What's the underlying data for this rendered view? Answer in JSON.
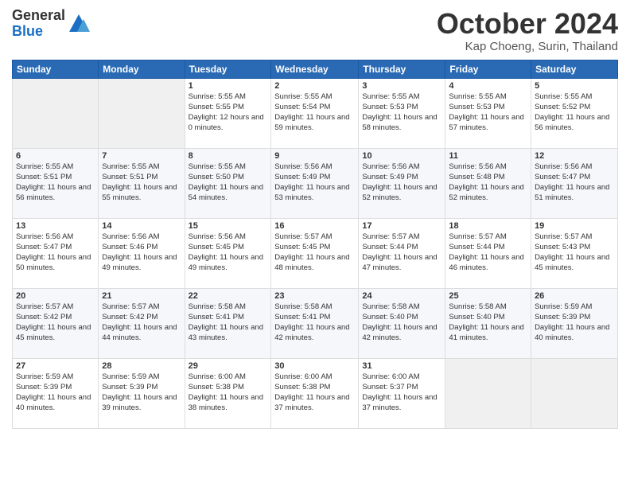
{
  "header": {
    "logo": {
      "line1": "General",
      "line2": "Blue"
    },
    "title": "October 2024",
    "location": "Kap Choeng, Surin, Thailand"
  },
  "weekdays": [
    "Sunday",
    "Monday",
    "Tuesday",
    "Wednesday",
    "Thursday",
    "Friday",
    "Saturday"
  ],
  "weeks": [
    [
      {
        "day": "",
        "sunrise": "",
        "sunset": "",
        "daylight": "",
        "empty": true
      },
      {
        "day": "",
        "sunrise": "",
        "sunset": "",
        "daylight": "",
        "empty": true
      },
      {
        "day": "1",
        "sunrise": "Sunrise: 5:55 AM",
        "sunset": "Sunset: 5:55 PM",
        "daylight": "Daylight: 12 hours and 0 minutes.",
        "empty": false
      },
      {
        "day": "2",
        "sunrise": "Sunrise: 5:55 AM",
        "sunset": "Sunset: 5:54 PM",
        "daylight": "Daylight: 11 hours and 59 minutes.",
        "empty": false
      },
      {
        "day": "3",
        "sunrise": "Sunrise: 5:55 AM",
        "sunset": "Sunset: 5:53 PM",
        "daylight": "Daylight: 11 hours and 58 minutes.",
        "empty": false
      },
      {
        "day": "4",
        "sunrise": "Sunrise: 5:55 AM",
        "sunset": "Sunset: 5:53 PM",
        "daylight": "Daylight: 11 hours and 57 minutes.",
        "empty": false
      },
      {
        "day": "5",
        "sunrise": "Sunrise: 5:55 AM",
        "sunset": "Sunset: 5:52 PM",
        "daylight": "Daylight: 11 hours and 56 minutes.",
        "empty": false
      }
    ],
    [
      {
        "day": "6",
        "sunrise": "Sunrise: 5:55 AM",
        "sunset": "Sunset: 5:51 PM",
        "daylight": "Daylight: 11 hours and 56 minutes.",
        "empty": false
      },
      {
        "day": "7",
        "sunrise": "Sunrise: 5:55 AM",
        "sunset": "Sunset: 5:51 PM",
        "daylight": "Daylight: 11 hours and 55 minutes.",
        "empty": false
      },
      {
        "day": "8",
        "sunrise": "Sunrise: 5:55 AM",
        "sunset": "Sunset: 5:50 PM",
        "daylight": "Daylight: 11 hours and 54 minutes.",
        "empty": false
      },
      {
        "day": "9",
        "sunrise": "Sunrise: 5:56 AM",
        "sunset": "Sunset: 5:49 PM",
        "daylight": "Daylight: 11 hours and 53 minutes.",
        "empty": false
      },
      {
        "day": "10",
        "sunrise": "Sunrise: 5:56 AM",
        "sunset": "Sunset: 5:49 PM",
        "daylight": "Daylight: 11 hours and 52 minutes.",
        "empty": false
      },
      {
        "day": "11",
        "sunrise": "Sunrise: 5:56 AM",
        "sunset": "Sunset: 5:48 PM",
        "daylight": "Daylight: 11 hours and 52 minutes.",
        "empty": false
      },
      {
        "day": "12",
        "sunrise": "Sunrise: 5:56 AM",
        "sunset": "Sunset: 5:47 PM",
        "daylight": "Daylight: 11 hours and 51 minutes.",
        "empty": false
      }
    ],
    [
      {
        "day": "13",
        "sunrise": "Sunrise: 5:56 AM",
        "sunset": "Sunset: 5:47 PM",
        "daylight": "Daylight: 11 hours and 50 minutes.",
        "empty": false
      },
      {
        "day": "14",
        "sunrise": "Sunrise: 5:56 AM",
        "sunset": "Sunset: 5:46 PM",
        "daylight": "Daylight: 11 hours and 49 minutes.",
        "empty": false
      },
      {
        "day": "15",
        "sunrise": "Sunrise: 5:56 AM",
        "sunset": "Sunset: 5:45 PM",
        "daylight": "Daylight: 11 hours and 49 minutes.",
        "empty": false
      },
      {
        "day": "16",
        "sunrise": "Sunrise: 5:57 AM",
        "sunset": "Sunset: 5:45 PM",
        "daylight": "Daylight: 11 hours and 48 minutes.",
        "empty": false
      },
      {
        "day": "17",
        "sunrise": "Sunrise: 5:57 AM",
        "sunset": "Sunset: 5:44 PM",
        "daylight": "Daylight: 11 hours and 47 minutes.",
        "empty": false
      },
      {
        "day": "18",
        "sunrise": "Sunrise: 5:57 AM",
        "sunset": "Sunset: 5:44 PM",
        "daylight": "Daylight: 11 hours and 46 minutes.",
        "empty": false
      },
      {
        "day": "19",
        "sunrise": "Sunrise: 5:57 AM",
        "sunset": "Sunset: 5:43 PM",
        "daylight": "Daylight: 11 hours and 45 minutes.",
        "empty": false
      }
    ],
    [
      {
        "day": "20",
        "sunrise": "Sunrise: 5:57 AM",
        "sunset": "Sunset: 5:42 PM",
        "daylight": "Daylight: 11 hours and 45 minutes.",
        "empty": false
      },
      {
        "day": "21",
        "sunrise": "Sunrise: 5:57 AM",
        "sunset": "Sunset: 5:42 PM",
        "daylight": "Daylight: 11 hours and 44 minutes.",
        "empty": false
      },
      {
        "day": "22",
        "sunrise": "Sunrise: 5:58 AM",
        "sunset": "Sunset: 5:41 PM",
        "daylight": "Daylight: 11 hours and 43 minutes.",
        "empty": false
      },
      {
        "day": "23",
        "sunrise": "Sunrise: 5:58 AM",
        "sunset": "Sunset: 5:41 PM",
        "daylight": "Daylight: 11 hours and 42 minutes.",
        "empty": false
      },
      {
        "day": "24",
        "sunrise": "Sunrise: 5:58 AM",
        "sunset": "Sunset: 5:40 PM",
        "daylight": "Daylight: 11 hours and 42 minutes.",
        "empty": false
      },
      {
        "day": "25",
        "sunrise": "Sunrise: 5:58 AM",
        "sunset": "Sunset: 5:40 PM",
        "daylight": "Daylight: 11 hours and 41 minutes.",
        "empty": false
      },
      {
        "day": "26",
        "sunrise": "Sunrise: 5:59 AM",
        "sunset": "Sunset: 5:39 PM",
        "daylight": "Daylight: 11 hours and 40 minutes.",
        "empty": false
      }
    ],
    [
      {
        "day": "27",
        "sunrise": "Sunrise: 5:59 AM",
        "sunset": "Sunset: 5:39 PM",
        "daylight": "Daylight: 11 hours and 40 minutes.",
        "empty": false
      },
      {
        "day": "28",
        "sunrise": "Sunrise: 5:59 AM",
        "sunset": "Sunset: 5:39 PM",
        "daylight": "Daylight: 11 hours and 39 minutes.",
        "empty": false
      },
      {
        "day": "29",
        "sunrise": "Sunrise: 6:00 AM",
        "sunset": "Sunset: 5:38 PM",
        "daylight": "Daylight: 11 hours and 38 minutes.",
        "empty": false
      },
      {
        "day": "30",
        "sunrise": "Sunrise: 6:00 AM",
        "sunset": "Sunset: 5:38 PM",
        "daylight": "Daylight: 11 hours and 37 minutes.",
        "empty": false
      },
      {
        "day": "31",
        "sunrise": "Sunrise: 6:00 AM",
        "sunset": "Sunset: 5:37 PM",
        "daylight": "Daylight: 11 hours and 37 minutes.",
        "empty": false
      },
      {
        "day": "",
        "sunrise": "",
        "sunset": "",
        "daylight": "",
        "empty": true
      },
      {
        "day": "",
        "sunrise": "",
        "sunset": "",
        "daylight": "",
        "empty": true
      }
    ]
  ]
}
